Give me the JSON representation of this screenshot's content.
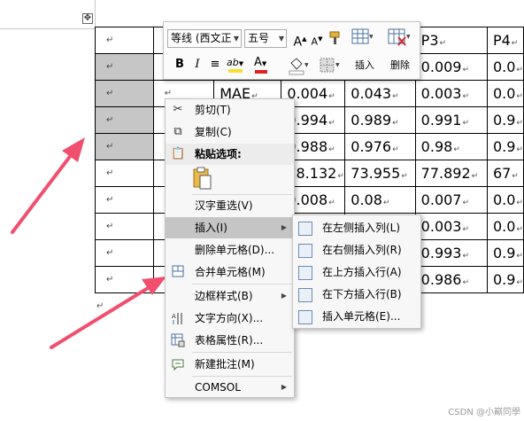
{
  "table": {
    "rows": [
      [
        "",
        "",
        "",
        "",
        "",
        "P3",
        "P4"
      ],
      [
        "",
        "",
        "",
        "",
        "",
        "0.009",
        "0.0"
      ],
      [
        "",
        "",
        "MAE",
        "0.004",
        "0.043",
        "0.003",
        "0.0"
      ],
      [
        "",
        "",
        "",
        "0.994",
        "0.989",
        "0.991",
        "0.9"
      ],
      [
        "",
        "",
        "",
        "0.988",
        "0.976",
        "0.98",
        "0.9"
      ],
      [
        "",
        "",
        "",
        "78.132",
        "73.955",
        "77.892",
        "67"
      ],
      [
        "",
        "",
        "",
        "0.008",
        "0.08",
        "0.007",
        "0.0"
      ],
      [
        "",
        "",
        "",
        "",
        "",
        "0.003",
        "0.0"
      ],
      [
        "",
        "",
        "",
        "",
        "",
        "0.993",
        "0.9"
      ],
      [
        "",
        "",
        "",
        "",
        "",
        "0.986",
        "0.9"
      ]
    ],
    "paragraph_mark": "↵",
    "move_handle_glyph": "✥"
  },
  "mini_toolbar": {
    "font_name": "等线 (西文正",
    "font_size": "五号",
    "grow_font": "A",
    "shrink_font": "A",
    "bold": "B",
    "italic": "I",
    "align": "≡",
    "highlight": "ab",
    "font_color": "A",
    "insert_label": "插入",
    "delete_label": "删除",
    "highlight_color": "#f5e02a",
    "font_color_value": "#e02020"
  },
  "context_menu": {
    "items": [
      {
        "label": "剪切(T)",
        "icon": "scissors-icon",
        "glyph": "✂"
      },
      {
        "label": "复制(C)",
        "icon": "copy-icon",
        "glyph": "⧉"
      }
    ],
    "paste_header": "粘贴选项:",
    "items2": [
      {
        "label": "汉字重选(V)"
      },
      {
        "label": "插入(I)",
        "submenu": true
      },
      {
        "label": "删除单元格(D)..."
      },
      {
        "label": "合并单元格(M)",
        "icon": "merge-cells-icon"
      },
      {
        "label": "边框样式(B)",
        "submenu": true
      },
      {
        "label": "文字方向(X)...",
        "icon": "text-direction-icon"
      },
      {
        "label": "表格属性(R)...",
        "icon": "table-properties-icon"
      },
      {
        "label": "新建批注(M)",
        "icon": "new-comment-icon"
      },
      {
        "label": "COMSOL",
        "submenu": true
      }
    ],
    "submenu_arrow": "▶"
  },
  "insert_submenu": {
    "items": [
      "在左侧插入列(L)",
      "在右侧插入列(R)",
      "在上方插入行(A)",
      "在下方插入行(B)",
      "插入单元格(E)..."
    ]
  },
  "watermark": "CSDN @小巅同學",
  "colors": {
    "arrow": "#f0506e",
    "highlight_row": "#c5c5c5",
    "selected_cell": "#c6c6c6"
  }
}
